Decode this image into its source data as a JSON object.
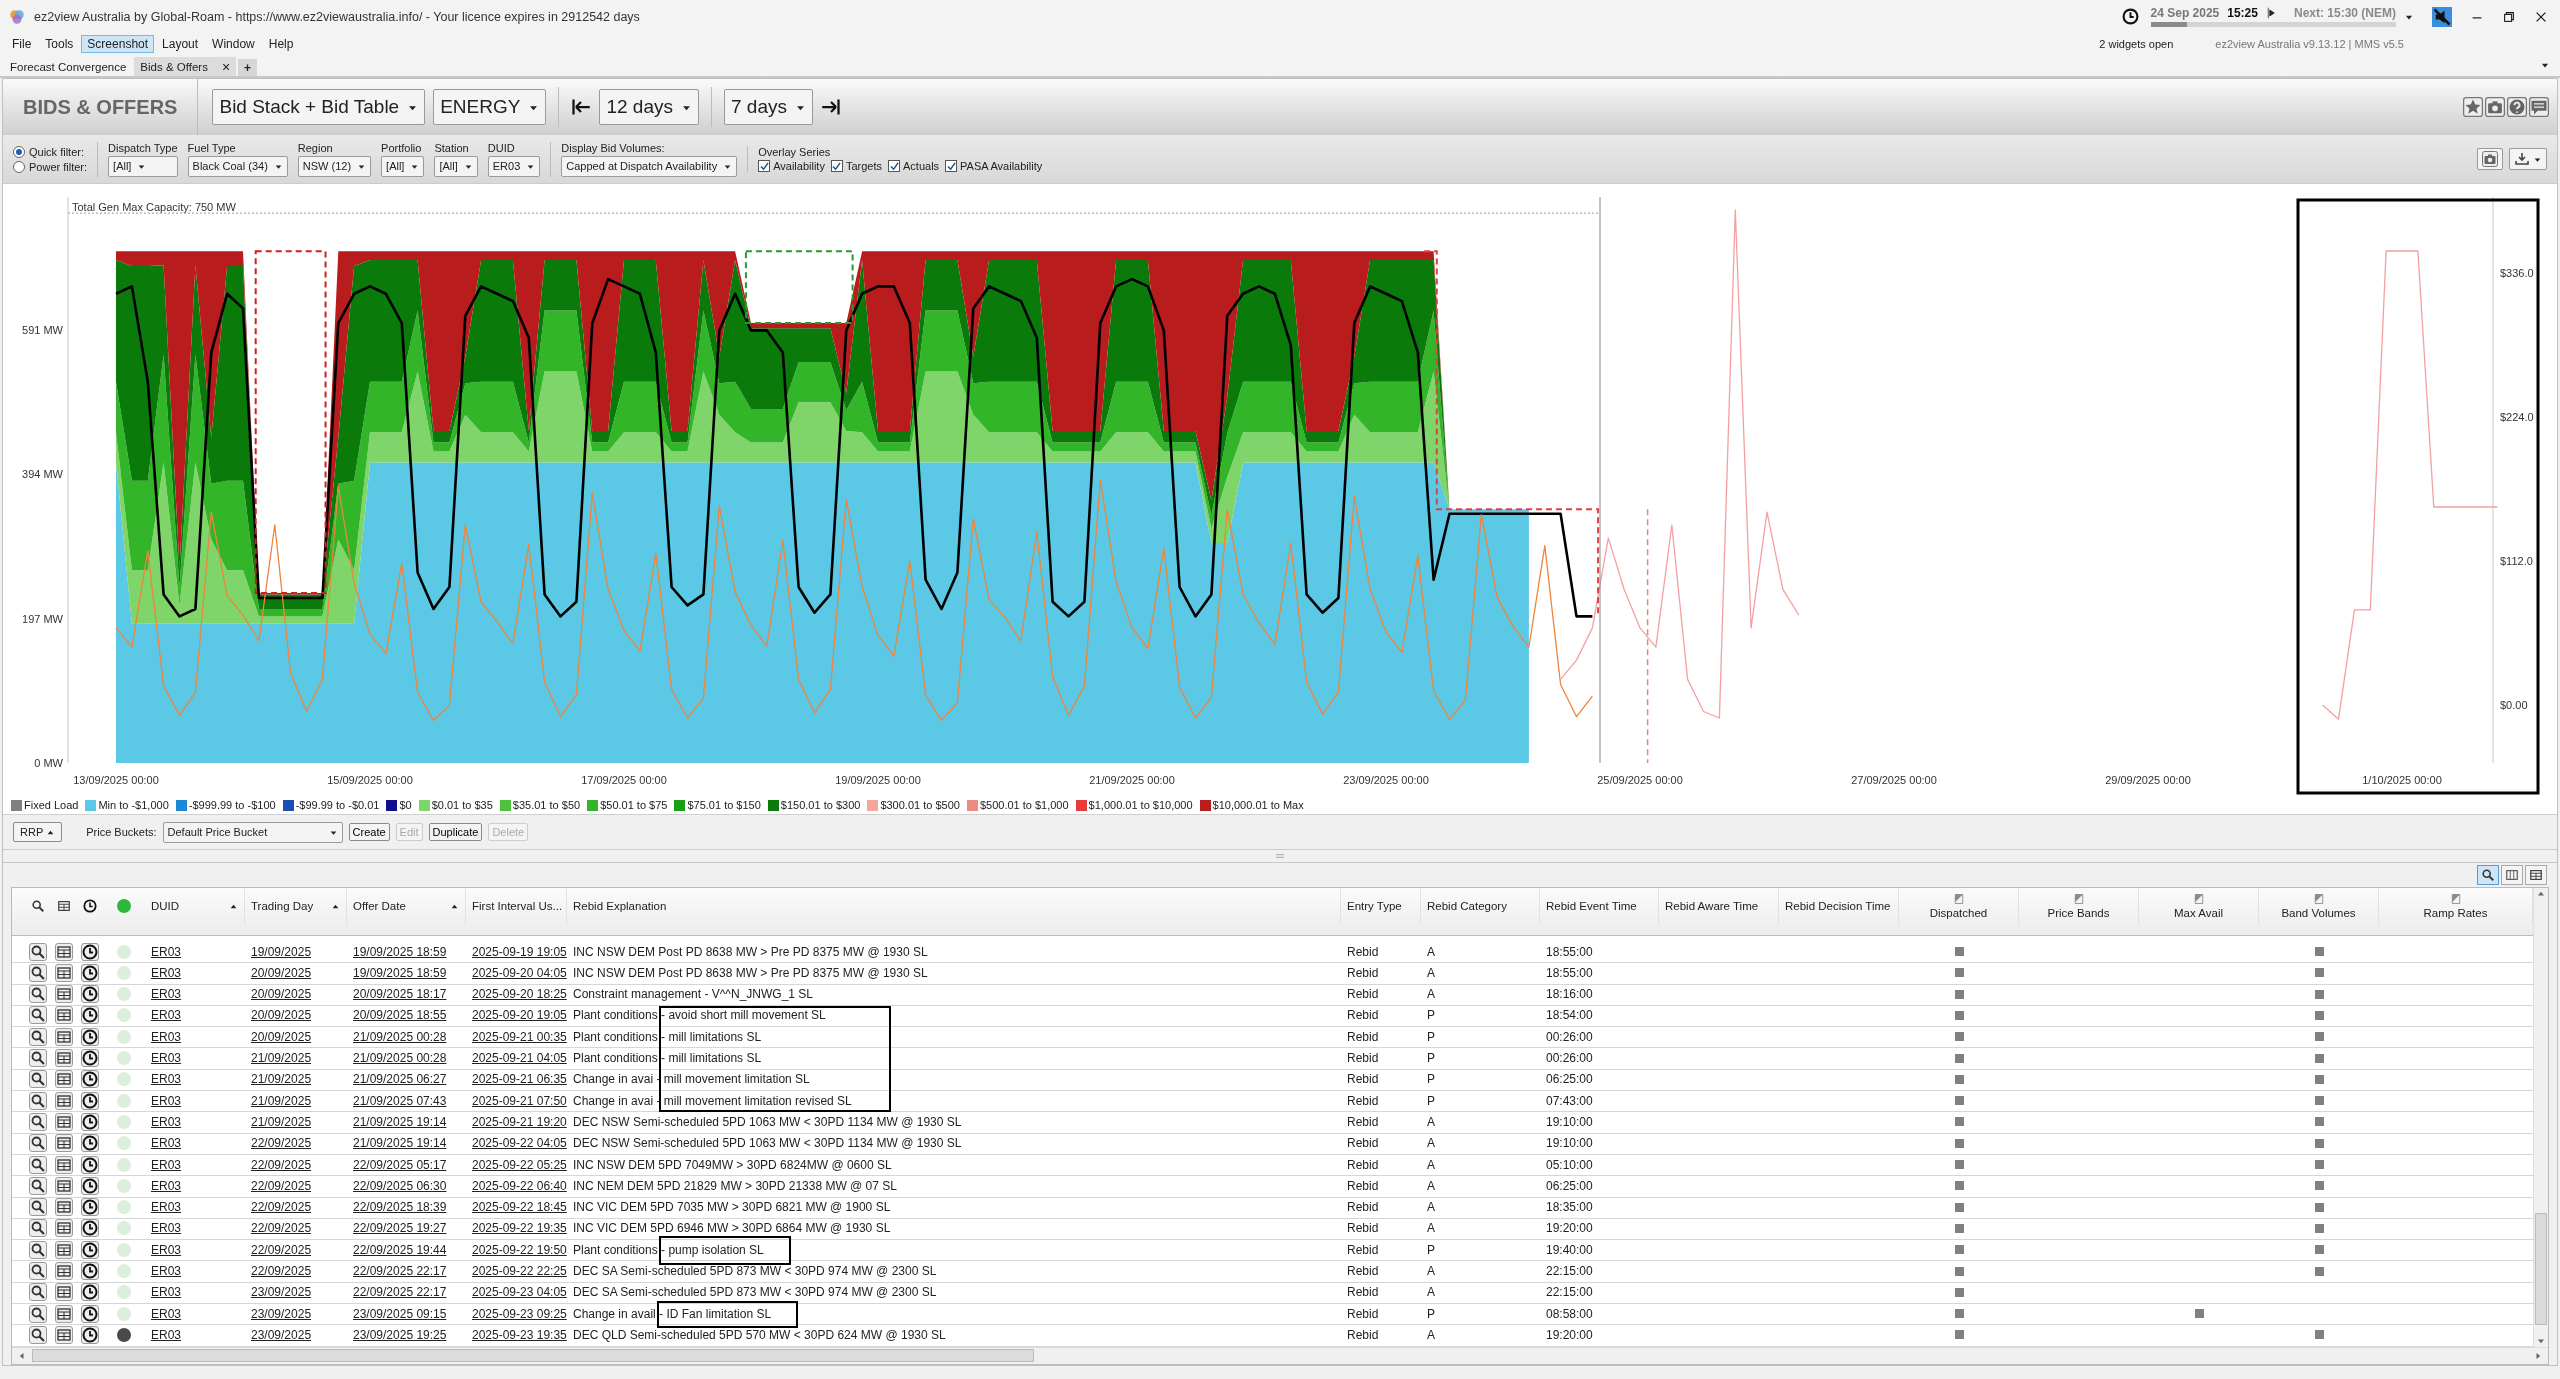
{
  "window": {
    "title": "ez2view Australia by Global-Roam - https://www.ez2viewaustralia.info/ - Your licence expires in 2912542 days"
  },
  "clock": {
    "date": "24 Sep 2025",
    "time": "15:25",
    "next": "Next: 15:30 (NEM)",
    "level": 0.15
  },
  "status": {
    "widgets": "2 widgets open",
    "version": "ez2view Australia v9.13.12 | MMS v5.5"
  },
  "menu": [
    {
      "label": "File",
      "selected": false
    },
    {
      "label": "Tools",
      "selected": false
    },
    {
      "label": "Screenshot",
      "selected": true
    },
    {
      "label": "Layout",
      "selected": false
    },
    {
      "label": "Window",
      "selected": false
    },
    {
      "label": "Help",
      "selected": false
    }
  ],
  "tabs": [
    {
      "label": "Forecast Convergence",
      "selected": false
    },
    {
      "label": "Bids & Offers",
      "selected": true,
      "close": "×"
    }
  ],
  "add_tab": "+",
  "toolbar": {
    "title": "BIDS & OFFERS",
    "view": "Bid Stack + Bid Table",
    "market": "ENERGY",
    "range": "12 days",
    "window": "7 days"
  },
  "filters": {
    "modes": [
      {
        "label": "Quick filter:",
        "selected": true
      },
      {
        "label": "Power filter:",
        "selected": false
      }
    ],
    "fields": [
      {
        "label": "Dispatch Type",
        "value": "[All]"
      },
      {
        "label": "Fuel Type",
        "value": "Black Coal (34)"
      },
      {
        "label": "Region",
        "value": "NSW (12)"
      },
      {
        "label": "Portfolio",
        "value": "[All]"
      },
      {
        "label": "Station",
        "value": "[All]"
      },
      {
        "label": "DUID",
        "value": "ER03"
      }
    ],
    "display": {
      "label": "Display Bid Volumes:",
      "value": "Capped at Dispatch Availability"
    },
    "overlay": {
      "label": "Overlay Series",
      "items": [
        {
          "label": "Availability",
          "checked": true
        },
        {
          "label": "Targets",
          "checked": true
        },
        {
          "label": "Actuals",
          "checked": true
        },
        {
          "label": "PASA Availability",
          "checked": true
        }
      ]
    }
  },
  "chart": {
    "capacity_label": "Total Gen Max Capacity: 750 MW",
    "chart_data": {
      "type": "area",
      "stacked": true,
      "categories": [
        "13/09/2025 00:00",
        null,
        null,
        null,
        null,
        null,
        null,
        null,
        null,
        null,
        null,
        null,
        null,
        null,
        null,
        null,
        "15/09/2025 00:00",
        null,
        null,
        null,
        null,
        null,
        null,
        null,
        null,
        null,
        null,
        null,
        null,
        null,
        null,
        null,
        "17/09/2025 00:00",
        null,
        null,
        null,
        null,
        null,
        null,
        null,
        null,
        null,
        null,
        null,
        null,
        null,
        null,
        null,
        "19/09/2025 00:00",
        null,
        null,
        null,
        null,
        null,
        null,
        null,
        null,
        null,
        null,
        null,
        null,
        null,
        null,
        null,
        "21/09/2025 00:00",
        null,
        null,
        null,
        null,
        null,
        null,
        null,
        null,
        null,
        null,
        null,
        null,
        null,
        null,
        null,
        "23/09/2025 00:00",
        null,
        null,
        null,
        null,
        null,
        null,
        null,
        null,
        null,
        null,
        null,
        null,
        null,
        null,
        null,
        "25/09/2025 00:00",
        null,
        null,
        null,
        null,
        null,
        null,
        null,
        null,
        null,
        null,
        null,
        null,
        null,
        null,
        null,
        "27/09/2025 00:00",
        null,
        null,
        null,
        null,
        null,
        null,
        null,
        null,
        null,
        null,
        null,
        null,
        null,
        null,
        null,
        "29/09/2025 00:00",
        null,
        null,
        null,
        null,
        null,
        null,
        null,
        null,
        null,
        null,
        null,
        null,
        null,
        null,
        null,
        "1/10/2025 00:00",
        null,
        null,
        null,
        null,
        null,
        null
      ],
      "ylim": [
        0,
        772
      ],
      "y2lim": [
        -45,
        395
      ],
      "yticks": [
        {
          "value": 591,
          "label": "591 MW"
        },
        {
          "value": 394,
          "label": "394 MW"
        },
        {
          "value": 197,
          "label": "197 MW"
        },
        {
          "value": 0,
          "label": "0 MW"
        }
      ],
      "y2ticks": [
        {
          "value": 336,
          "label": "$336.0"
        },
        {
          "value": 224,
          "label": "$224.0"
        },
        {
          "value": 112,
          "label": "$112.0"
        },
        {
          "value": 0,
          "label": "$0.00"
        }
      ],
      "series": [
        {
          "type": "area",
          "color": "#5bc8e6",
          "values": [
            410,
            190,
            190,
            190,
            190,
            190,
            190,
            190,
            190,
            190,
            190,
            190,
            190,
            190,
            190,
            190,
            410,
            410,
            410,
            410,
            410,
            410,
            410,
            410,
            410,
            410,
            410,
            410,
            410,
            410,
            410,
            410,
            410,
            410,
            410,
            410,
            410,
            410,
            410,
            410,
            410,
            410,
            410,
            410,
            410,
            410,
            410,
            410,
            410,
            410,
            410,
            410,
            410,
            410,
            410,
            410,
            410,
            410,
            410,
            410,
            410,
            410,
            410,
            410,
            410,
            410,
            410,
            410,
            410,
            300,
            300,
            410,
            410,
            410,
            410,
            410,
            410,
            410,
            410,
            410,
            410,
            410,
            410,
            410,
            346,
            346,
            346,
            346,
            346,
            346,
            null,
            null,
            null,
            null,
            null,
            null,
            null,
            null,
            null,
            null,
            null,
            null,
            null,
            null,
            null,
            null,
            null,
            null,
            null,
            null,
            null,
            null,
            null,
            null,
            null,
            null,
            null,
            null,
            null,
            null,
            null,
            null,
            null,
            null,
            null,
            null,
            null,
            null,
            null,
            null,
            null,
            null,
            null,
            null,
            null,
            null,
            null,
            null,
            null,
            null,
            null,
            null,
            null,
            null,
            null,
            null,
            null,
            null,
            null,
            null,
            null
          ]
        },
        {
          "type": "area",
          "color": "#7fd56a",
          "values": [
            41,
            73,
            73,
            220,
            25,
            220,
            115,
            73,
            73,
            10,
            10,
            10,
            10,
            10,
            115,
            73,
            41,
            41,
            41,
            124,
            15,
            15,
            65,
            41,
            41,
            41,
            15,
            124,
            124,
            124,
            15,
            15,
            41,
            41,
            41,
            15,
            15,
            124,
            65,
            41,
            27,
            27,
            27,
            82,
            82,
            82,
            43,
            41,
            15,
            15,
            15,
            124,
            124,
            124,
            65,
            41,
            41,
            41,
            41,
            15,
            15,
            15,
            15,
            41,
            41,
            41,
            15,
            15,
            15,
            20,
            90,
            41,
            41,
            41,
            41,
            15,
            15,
            15,
            65,
            41,
            41,
            41,
            41,
            124,
            0,
            0,
            0,
            0,
            0,
            0,
            null,
            null,
            null,
            null,
            null,
            null,
            null,
            null,
            null,
            null,
            null,
            null,
            null,
            null,
            null,
            null,
            null,
            null,
            null,
            null,
            null,
            null,
            null,
            null,
            null,
            null,
            null,
            null,
            null,
            null,
            null,
            null,
            null,
            null,
            null,
            null,
            null,
            null,
            null,
            null,
            null,
            null,
            null,
            null,
            null,
            null,
            null,
            null,
            null,
            null,
            null,
            null,
            null,
            null,
            null,
            null,
            null,
            null,
            null,
            null,
            null
          ]
        },
        {
          "type": "area",
          "color": "#33b52a",
          "values": [
            69,
            122,
            122,
            147,
            25,
            147,
            76,
            122,
            122,
            10,
            10,
            10,
            10,
            10,
            76,
            122,
            69,
            69,
            69,
            83,
            12,
            12,
            43,
            69,
            69,
            69,
            12,
            83,
            83,
            83,
            12,
            12,
            69,
            69,
            69,
            12,
            12,
            83,
            43,
            69,
            46,
            46,
            46,
            55,
            55,
            55,
            28,
            69,
            12,
            12,
            12,
            83,
            83,
            83,
            43,
            69,
            69,
            69,
            69,
            12,
            12,
            12,
            12,
            69,
            69,
            69,
            12,
            12,
            12,
            18,
            60,
            69,
            69,
            69,
            69,
            12,
            12,
            12,
            43,
            69,
            69,
            69,
            69,
            83,
            0,
            0,
            0,
            0,
            0,
            0,
            null,
            null,
            null,
            null,
            null,
            null,
            null,
            null,
            null,
            null,
            null,
            null,
            null,
            null,
            null,
            null,
            null,
            null,
            null,
            null,
            null,
            null,
            null,
            null,
            null,
            null,
            null,
            null,
            null,
            null,
            null,
            null,
            null,
            null,
            null,
            null,
            null,
            null,
            null,
            null,
            null,
            null,
            null,
            null,
            null,
            null,
            null,
            null,
            null,
            null,
            null,
            null,
            null,
            null,
            null,
            null,
            null,
            null,
            null,
            null,
            null
          ]
        },
        {
          "type": "area",
          "color": "#0a7a0a",
          "values": [
            166,
            293,
            293,
            122,
            26,
            122,
            63,
            293,
            293,
            20,
            20,
            20,
            20,
            20,
            63,
            293,
            166,
            166,
            166,
            69,
            16,
            16,
            36,
            166,
            166,
            166,
            16,
            69,
            69,
            69,
            16,
            16,
            166,
            166,
            166,
            16,
            16,
            69,
            36,
            166,
            110,
            110,
            110,
            46,
            46,
            46,
            24,
            166,
            16,
            16,
            16,
            69,
            69,
            69,
            36,
            166,
            166,
            166,
            166,
            16,
            16,
            16,
            16,
            166,
            166,
            166,
            16,
            16,
            16,
            20,
            50,
            166,
            166,
            166,
            166,
            16,
            16,
            16,
            36,
            166,
            166,
            166,
            166,
            69,
            0,
            0,
            0,
            0,
            0,
            0,
            null,
            null,
            null,
            null,
            null,
            null,
            null,
            null,
            null,
            null,
            null,
            null,
            null,
            null,
            null,
            null,
            null,
            null,
            null,
            null,
            null,
            null,
            null,
            null,
            null,
            null,
            null,
            null,
            null,
            null,
            null,
            null,
            null,
            null,
            null,
            null,
            null,
            null,
            null,
            null,
            null,
            null,
            null,
            null,
            null,
            null,
            null,
            null,
            null,
            null,
            null,
            null,
            null,
            null,
            null,
            null,
            null,
            null,
            null,
            null,
            null
          ]
        },
        {
          "type": "area",
          "color": "#b81c1c",
          "values": [
            12,
            20,
            20,
            19,
            432,
            19,
            254,
            20,
            20,
            2,
            2,
            2,
            2,
            2,
            254,
            20,
            12,
            12,
            12,
            12,
            245,
            245,
            144,
            12,
            12,
            12,
            245,
            12,
            12,
            12,
            245,
            245,
            12,
            12,
            12,
            245,
            245,
            12,
            144,
            12,
            7,
            7,
            7,
            7,
            7,
            7,
            95,
            12,
            245,
            245,
            245,
            12,
            12,
            12,
            144,
            12,
            12,
            12,
            12,
            245,
            245,
            245,
            245,
            12,
            12,
            12,
            245,
            245,
            245,
            340,
            198,
            12,
            12,
            12,
            12,
            245,
            245,
            245,
            144,
            12,
            12,
            12,
            12,
            12,
            0,
            0,
            0,
            0,
            0,
            0,
            null,
            null,
            null,
            null,
            null,
            null,
            null,
            null,
            null,
            null,
            null,
            null,
            null,
            null,
            null,
            null,
            null,
            null,
            null,
            null,
            null,
            null,
            null,
            null,
            null,
            null,
            null,
            null,
            null,
            null,
            null,
            null,
            null,
            null,
            null,
            null,
            null,
            null,
            null,
            null,
            null,
            null,
            null,
            null,
            null,
            null,
            null,
            null,
            null,
            null,
            null,
            null,
            null,
            null,
            null,
            null,
            null,
            null,
            null,
            null,
            null
          ]
        },
        {
          "type": "line",
          "color": "#000000",
          "values": [
            640,
            650,
            520,
            230,
            200,
            210,
            560,
            640,
            620,
            225,
            225,
            225,
            225,
            225,
            600,
            640,
            650,
            640,
            600,
            260,
            210,
            240,
            610,
            650,
            640,
            630,
            580,
            230,
            200,
            220,
            600,
            660,
            650,
            640,
            560,
            240,
            215,
            230,
            590,
            640,
            590,
            590,
            560,
            240,
            205,
            230,
            590,
            640,
            650,
            650,
            600,
            250,
            210,
            260,
            620,
            650,
            640,
            630,
            580,
            220,
            200,
            220,
            600,
            650,
            660,
            650,
            590,
            240,
            200,
            230,
            610,
            640,
            650,
            640,
            570,
            230,
            205,
            225,
            600,
            650,
            640,
            630,
            560,
            250,
            340,
            340,
            340,
            340,
            340,
            340,
            340,
            340,
            200,
            200,
            null,
            null,
            null,
            null,
            null,
            null,
            null,
            null,
            null,
            null,
            null,
            null,
            null,
            null,
            null,
            null,
            null,
            null,
            null,
            null,
            null,
            null,
            null,
            null,
            null,
            null,
            null,
            null,
            null,
            null,
            null,
            null,
            null,
            null,
            null,
            null,
            null,
            null,
            null,
            null,
            null,
            null,
            null,
            null,
            null,
            null,
            null,
            null,
            null,
            null,
            null,
            null,
            null,
            null,
            null,
            null,
            null
          ]
        },
        {
          "type": "line",
          "color": "#f0843a",
          "axis": "y2",
          "values": [
            60,
            45,
            120,
            15,
            -8,
            10,
            150,
            85,
            70,
            50,
            140,
            25,
            -5,
            20,
            170,
            95,
            55,
            40,
            110,
            10,
            -12,
            0,
            140,
            80,
            65,
            48,
            125,
            18,
            -9,
            8,
            165,
            90,
            58,
            42,
            118,
            12,
            -10,
            5,
            155,
            88,
            62,
            46,
            128,
            20,
            -6,
            12,
            160,
            92,
            54,
            38,
            112,
            8,
            -12,
            2,
            145,
            82,
            68,
            50,
            135,
            22,
            -8,
            15,
            175,
            96,
            60,
            44,
            122,
            14,
            -10,
            6,
            152,
            86,
            64,
            47,
            126,
            18,
            -7,
            10,
            162,
            90,
            57,
            41,
            116,
            11,
            -11,
            4,
            148,
            84,
            61,
            45,
            124,
            16,
            -9,
            7,
            null,
            null,
            null,
            null,
            null,
            null,
            null,
            null,
            null,
            null,
            null,
            null,
            null,
            null,
            null,
            null,
            null,
            null,
            null,
            null,
            null,
            null,
            null,
            null,
            null,
            null,
            null,
            null,
            null,
            null,
            null,
            null,
            null,
            null,
            null,
            null,
            null,
            null,
            null,
            null,
            null,
            null,
            null,
            null,
            null,
            null,
            null,
            null,
            null,
            null,
            null,
            null,
            null,
            null,
            null,
            null,
            null
          ]
        },
        {
          "type": "line",
          "color": "#f4a0a0",
          "axis": "y2",
          "values": [
            null,
            null,
            null,
            null,
            null,
            null,
            null,
            null,
            null,
            null,
            null,
            null,
            null,
            null,
            null,
            null,
            null,
            null,
            null,
            null,
            null,
            null,
            null,
            null,
            null,
            null,
            null,
            null,
            null,
            null,
            null,
            null,
            null,
            null,
            null,
            null,
            null,
            null,
            null,
            null,
            null,
            null,
            null,
            null,
            null,
            null,
            null,
            null,
            null,
            null,
            null,
            null,
            null,
            null,
            null,
            null,
            null,
            null,
            null,
            null,
            null,
            null,
            null,
            null,
            null,
            null,
            null,
            null,
            null,
            null,
            null,
            null,
            null,
            null,
            null,
            null,
            null,
            null,
            null,
            null,
            null,
            null,
            null,
            null,
            null,
            null,
            null,
            null,
            null,
            null,
            null,
            20,
            35,
            60,
            130,
            90,
            60,
            45,
            140,
            20,
            -5,
            -10,
            385,
            60,
            150,
            90,
            70,
            null,
            null,
            null,
            null,
            null,
            null,
            null,
            null,
            null,
            null,
            null,
            null,
            null,
            null,
            null,
            null,
            null,
            null,
            null,
            null,
            null,
            null,
            null,
            null,
            null,
            null,
            null,
            null,
            null,
            null,
            null,
            null,
            0,
            -11,
            74,
            74,
            353,
            353,
            353,
            154,
            154,
            154,
            154,
            154
          ]
        }
      ]
    }
  },
  "legend": [
    {
      "label": "Fixed Load",
      "color": "#808080"
    },
    {
      "label": "Min to -$1,000",
      "color": "#5bc8e6"
    },
    {
      "label": "-$999.99 to -$100",
      "color": "#1e88d8"
    },
    {
      "label": "-$99.99 to -$0.01",
      "color": "#1a4fb0"
    },
    {
      "label": "$0",
      "color": "#10108c"
    },
    {
      "label": "$0.01 to $35",
      "color": "#7fd56a"
    },
    {
      "label": "$35.01 to $50",
      "color": "#4cc23a"
    },
    {
      "label": "$50.01 to $75",
      "color": "#33b52a"
    },
    {
      "label": "$75.01 to $150",
      "color": "#19a019"
    },
    {
      "label": "$150.01 to $300",
      "color": "#0a7a0a"
    },
    {
      "label": "$300.01 to $500",
      "color": "#f6a59a"
    },
    {
      "label": "$500.01 to $1,000",
      "color": "#f08a80"
    },
    {
      "label": "$1,000.01 to $10,000",
      "color": "#e83c3c"
    },
    {
      "label": "$10,000.01 to Max",
      "color": "#b81c1c"
    }
  ],
  "buckets": {
    "rrp": "RRP",
    "label": "Price Buckets:",
    "value": "Default Price Bucket",
    "buttons": [
      {
        "label": "Create",
        "disabled": false
      },
      {
        "label": "Edit",
        "disabled": true
      },
      {
        "label": "Duplicate",
        "disabled": false
      },
      {
        "label": "Delete",
        "disabled": true
      }
    ]
  },
  "table": {
    "columns": [
      {
        "label": "DUID",
        "kind": "text",
        "sorted": true
      },
      {
        "label": "Trading Day",
        "kind": "text",
        "sorted": true
      },
      {
        "label": "Offer Date",
        "kind": "text",
        "sorted": true
      },
      {
        "label": "First Interval Us...",
        "kind": "text",
        "sorted": false
      },
      {
        "label": "Rebid Explanation",
        "kind": "text",
        "sorted": false
      },
      {
        "label": "Entry Type",
        "kind": "text",
        "sorted": false
      },
      {
        "label": "Rebid Category",
        "kind": "text",
        "sorted": false
      },
      {
        "label": "Rebid Event Time",
        "kind": "text",
        "sorted": false
      },
      {
        "label": "Rebid Aware Time",
        "kind": "text",
        "sorted": false
      },
      {
        "label": "Rebid Decision Time",
        "kind": "text",
        "sorted": false
      },
      {
        "label": "Dispatched",
        "kind": "flag",
        "sorted": false
      },
      {
        "label": "Price Bands",
        "kind": "flag",
        "sorted": false
      },
      {
        "label": "Max Avail",
        "kind": "flag",
        "sorted": false
      },
      {
        "label": "Band Volumes",
        "kind": "flag",
        "sorted": false
      },
      {
        "label": "Ramp Rates",
        "kind": "flag",
        "sorted": false
      }
    ],
    "rows": [
      {
        "latest": false,
        "cells": [
          "ER03",
          "19/09/2025",
          "19/09/2025 18:59",
          "2025-09-19 19:05",
          "INC NSW DEM Post PD 8638 MW > Pre PD 8375 MW @ 1930 SL",
          "Rebid",
          "A",
          "18:55:00"
        ],
        "flags": [
          true,
          false,
          false,
          true,
          false
        ]
      },
      {
        "latest": false,
        "cells": [
          "ER03",
          "20/09/2025",
          "19/09/2025 18:59",
          "2025-09-20 04:05",
          "INC NSW DEM Post PD 8638 MW > Pre PD 8375 MW @ 1930 SL",
          "Rebid",
          "A",
          "18:55:00"
        ],
        "flags": [
          true,
          false,
          false,
          true,
          false
        ]
      },
      {
        "latest": false,
        "cells": [
          "ER03",
          "20/09/2025",
          "20/09/2025 18:17",
          "2025-09-20 18:25",
          "Constraint management - V^^N_JNWG_1 SL",
          "Rebid",
          "A",
          "18:16:00"
        ],
        "flags": [
          true,
          false,
          false,
          true,
          false
        ]
      },
      {
        "latest": false,
        "cells": [
          "ER03",
          "20/09/2025",
          "20/09/2025 18:55",
          "2025-09-20 19:05",
          "Plant conditions - avoid short mill movement SL",
          "Rebid",
          "P",
          "18:54:00"
        ],
        "flags": [
          true,
          false,
          false,
          true,
          false
        ]
      },
      {
        "latest": false,
        "cells": [
          "ER03",
          "20/09/2025",
          "21/09/2025 00:28",
          "2025-09-21 00:35",
          "Plant conditions - mill limitations SL",
          "Rebid",
          "P",
          "00:26:00"
        ],
        "flags": [
          true,
          false,
          false,
          true,
          false
        ]
      },
      {
        "latest": false,
        "cells": [
          "ER03",
          "21/09/2025",
          "21/09/2025 00:28",
          "2025-09-21 04:05",
          "Plant conditions - mill limitations SL",
          "Rebid",
          "P",
          "00:26:00"
        ],
        "flags": [
          true,
          false,
          false,
          true,
          false
        ]
      },
      {
        "latest": false,
        "cells": [
          "ER03",
          "21/09/2025",
          "21/09/2025 06:27",
          "2025-09-21 06:35",
          "Change in avai - mill movement limitation SL",
          "Rebid",
          "P",
          "06:25:00"
        ],
        "flags": [
          true,
          false,
          false,
          true,
          false
        ]
      },
      {
        "latest": false,
        "cells": [
          "ER03",
          "21/09/2025",
          "21/09/2025 07:43",
          "2025-09-21 07:50",
          "Change in avai - mill movement limitation revised SL",
          "Rebid",
          "P",
          "07:43:00"
        ],
        "flags": [
          true,
          false,
          false,
          true,
          false
        ]
      },
      {
        "latest": false,
        "cells": [
          "ER03",
          "21/09/2025",
          "21/09/2025 19:14",
          "2025-09-21 19:20",
          "DEC NSW Semi-scheduled 5PD 1063 MW < 30PD 1134 MW @ 1930 SL",
          "Rebid",
          "A",
          "19:10:00"
        ],
        "flags": [
          true,
          false,
          false,
          true,
          false
        ]
      },
      {
        "latest": false,
        "cells": [
          "ER03",
          "22/09/2025",
          "21/09/2025 19:14",
          "2025-09-22 04:05",
          "DEC NSW Semi-scheduled 5PD 1063 MW < 30PD 1134 MW @ 1930 SL",
          "Rebid",
          "A",
          "19:10:00"
        ],
        "flags": [
          true,
          false,
          false,
          true,
          false
        ]
      },
      {
        "latest": false,
        "cells": [
          "ER03",
          "22/09/2025",
          "22/09/2025 05:17",
          "2025-09-22 05:25",
          "INC NSW DEM 5PD 7049MW > 30PD 6824MW @ 0600 SL",
          "Rebid",
          "A",
          "05:10:00"
        ],
        "flags": [
          true,
          false,
          false,
          true,
          false
        ]
      },
      {
        "latest": false,
        "cells": [
          "ER03",
          "22/09/2025",
          "22/09/2025 06:30",
          "2025-09-22 06:40",
          "INC NEM DEM 5PD 21829 MW > 30PD 21338 MW @ 07 SL",
          "Rebid",
          "A",
          "06:25:00"
        ],
        "flags": [
          true,
          false,
          false,
          true,
          false
        ]
      },
      {
        "latest": false,
        "cells": [
          "ER03",
          "22/09/2025",
          "22/09/2025 18:39",
          "2025-09-22 18:45",
          "INC VIC DEM 5PD 7035 MW > 30PD 6821 MW @ 1900 SL",
          "Rebid",
          "A",
          "18:35:00"
        ],
        "flags": [
          true,
          false,
          false,
          true,
          false
        ]
      },
      {
        "latest": false,
        "cells": [
          "ER03",
          "22/09/2025",
          "22/09/2025 19:27",
          "2025-09-22 19:35",
          "INC VIC DEM 5PD 6946 MW > 30PD 6864 MW @ 1930 SL",
          "Rebid",
          "A",
          "19:20:00"
        ],
        "flags": [
          true,
          false,
          false,
          true,
          false
        ]
      },
      {
        "latest": false,
        "cells": [
          "ER03",
          "22/09/2025",
          "22/09/2025 19:44",
          "2025-09-22 19:50",
          "Plant conditions - pump isolation SL",
          "Rebid",
          "P",
          "19:40:00"
        ],
        "flags": [
          true,
          false,
          false,
          true,
          false
        ]
      },
      {
        "latest": false,
        "cells": [
          "ER03",
          "22/09/2025",
          "22/09/2025 22:17",
          "2025-09-22 22:25",
          "DEC SA Semi-scheduled 5PD 873 MW < 30PD 974 MW @ 2300 SL",
          "Rebid",
          "A",
          "22:15:00"
        ],
        "flags": [
          true,
          false,
          false,
          true,
          false
        ]
      },
      {
        "latest": false,
        "cells": [
          "ER03",
          "23/09/2025",
          "22/09/2025 22:17",
          "2025-09-23 04:05",
          "DEC SA Semi-scheduled 5PD 873 MW < 30PD 974 MW @ 2300 SL",
          "Rebid",
          "A",
          "22:15:00"
        ],
        "flags": [
          true,
          false,
          false,
          false,
          false
        ]
      },
      {
        "latest": false,
        "cells": [
          "ER03",
          "23/09/2025",
          "23/09/2025 09:15",
          "2025-09-23 09:25",
          "Change in avail - ID Fan limitation SL",
          "Rebid",
          "P",
          "08:58:00"
        ],
        "flags": [
          true,
          false,
          true,
          false,
          false
        ]
      },
      {
        "latest": true,
        "cells": [
          "ER03",
          "23/09/2025",
          "23/09/2025 19:25",
          "2025-09-23 19:35",
          "DEC QLD Semi-scheduled 5PD 570 MW < 30PD 624 MW @ 1930 SL",
          "Rebid",
          "A",
          "19:20:00"
        ],
        "flags": [
          true,
          false,
          false,
          true,
          false
        ]
      }
    ]
  }
}
